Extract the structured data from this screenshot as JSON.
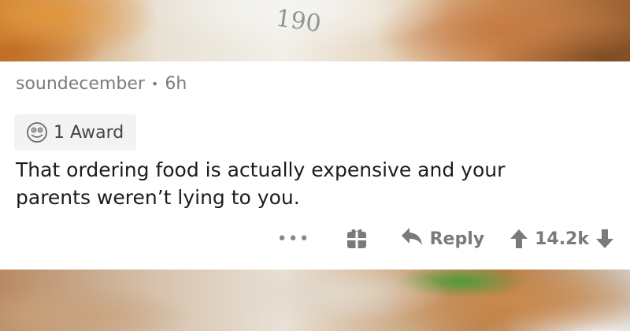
{
  "comment": {
    "author": "soundecember",
    "separator": "•",
    "age": "6h",
    "award_label": "1 Award",
    "body_line1": "That ordering food is actually expensive and your",
    "body_line2": "parents weren’t lying to you."
  },
  "actions": {
    "more_label": "•••",
    "reply_label": "Reply",
    "score": "14.2k"
  },
  "photo_text": {
    "wrapper_scribble": "190"
  },
  "colors": {
    "meta_text": "#7c7c7c",
    "body_text": "#1c1c1c",
    "action_gray": "#7a7a7a",
    "award_chip_bg": "#f3f3f3"
  },
  "icons": [
    "award-face-icon",
    "gift-box-icon",
    "reply-arrow-icon",
    "upvote-arrow-icon",
    "downvote-arrow-icon"
  ]
}
